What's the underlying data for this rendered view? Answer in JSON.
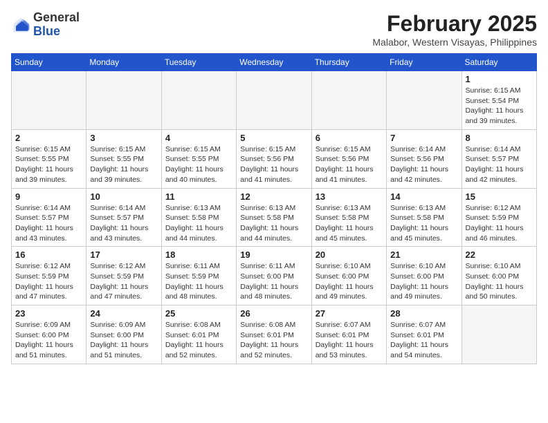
{
  "header": {
    "logo_general": "General",
    "logo_blue": "Blue",
    "month_year": "February 2025",
    "location": "Malabor, Western Visayas, Philippines"
  },
  "days_of_week": [
    "Sunday",
    "Monday",
    "Tuesday",
    "Wednesday",
    "Thursday",
    "Friday",
    "Saturday"
  ],
  "weeks": [
    [
      {
        "day": "",
        "info": ""
      },
      {
        "day": "",
        "info": ""
      },
      {
        "day": "",
        "info": ""
      },
      {
        "day": "",
        "info": ""
      },
      {
        "day": "",
        "info": ""
      },
      {
        "day": "",
        "info": ""
      },
      {
        "day": "1",
        "info": "Sunrise: 6:15 AM\nSunset: 5:54 PM\nDaylight: 11 hours\nand 39 minutes."
      }
    ],
    [
      {
        "day": "2",
        "info": "Sunrise: 6:15 AM\nSunset: 5:55 PM\nDaylight: 11 hours\nand 39 minutes."
      },
      {
        "day": "3",
        "info": "Sunrise: 6:15 AM\nSunset: 5:55 PM\nDaylight: 11 hours\nand 39 minutes."
      },
      {
        "day": "4",
        "info": "Sunrise: 6:15 AM\nSunset: 5:55 PM\nDaylight: 11 hours\nand 40 minutes."
      },
      {
        "day": "5",
        "info": "Sunrise: 6:15 AM\nSunset: 5:56 PM\nDaylight: 11 hours\nand 41 minutes."
      },
      {
        "day": "6",
        "info": "Sunrise: 6:15 AM\nSunset: 5:56 PM\nDaylight: 11 hours\nand 41 minutes."
      },
      {
        "day": "7",
        "info": "Sunrise: 6:14 AM\nSunset: 5:56 PM\nDaylight: 11 hours\nand 42 minutes."
      },
      {
        "day": "8",
        "info": "Sunrise: 6:14 AM\nSunset: 5:57 PM\nDaylight: 11 hours\nand 42 minutes."
      }
    ],
    [
      {
        "day": "9",
        "info": "Sunrise: 6:14 AM\nSunset: 5:57 PM\nDaylight: 11 hours\nand 43 minutes."
      },
      {
        "day": "10",
        "info": "Sunrise: 6:14 AM\nSunset: 5:57 PM\nDaylight: 11 hours\nand 43 minutes."
      },
      {
        "day": "11",
        "info": "Sunrise: 6:13 AM\nSunset: 5:58 PM\nDaylight: 11 hours\nand 44 minutes."
      },
      {
        "day": "12",
        "info": "Sunrise: 6:13 AM\nSunset: 5:58 PM\nDaylight: 11 hours\nand 44 minutes."
      },
      {
        "day": "13",
        "info": "Sunrise: 6:13 AM\nSunset: 5:58 PM\nDaylight: 11 hours\nand 45 minutes."
      },
      {
        "day": "14",
        "info": "Sunrise: 6:13 AM\nSunset: 5:58 PM\nDaylight: 11 hours\nand 45 minutes."
      },
      {
        "day": "15",
        "info": "Sunrise: 6:12 AM\nSunset: 5:59 PM\nDaylight: 11 hours\nand 46 minutes."
      }
    ],
    [
      {
        "day": "16",
        "info": "Sunrise: 6:12 AM\nSunset: 5:59 PM\nDaylight: 11 hours\nand 47 minutes."
      },
      {
        "day": "17",
        "info": "Sunrise: 6:12 AM\nSunset: 5:59 PM\nDaylight: 11 hours\nand 47 minutes."
      },
      {
        "day": "18",
        "info": "Sunrise: 6:11 AM\nSunset: 5:59 PM\nDaylight: 11 hours\nand 48 minutes."
      },
      {
        "day": "19",
        "info": "Sunrise: 6:11 AM\nSunset: 6:00 PM\nDaylight: 11 hours\nand 48 minutes."
      },
      {
        "day": "20",
        "info": "Sunrise: 6:10 AM\nSunset: 6:00 PM\nDaylight: 11 hours\nand 49 minutes."
      },
      {
        "day": "21",
        "info": "Sunrise: 6:10 AM\nSunset: 6:00 PM\nDaylight: 11 hours\nand 49 minutes."
      },
      {
        "day": "22",
        "info": "Sunrise: 6:10 AM\nSunset: 6:00 PM\nDaylight: 11 hours\nand 50 minutes."
      }
    ],
    [
      {
        "day": "23",
        "info": "Sunrise: 6:09 AM\nSunset: 6:00 PM\nDaylight: 11 hours\nand 51 minutes."
      },
      {
        "day": "24",
        "info": "Sunrise: 6:09 AM\nSunset: 6:00 PM\nDaylight: 11 hours\nand 51 minutes."
      },
      {
        "day": "25",
        "info": "Sunrise: 6:08 AM\nSunset: 6:01 PM\nDaylight: 11 hours\nand 52 minutes."
      },
      {
        "day": "26",
        "info": "Sunrise: 6:08 AM\nSunset: 6:01 PM\nDaylight: 11 hours\nand 52 minutes."
      },
      {
        "day": "27",
        "info": "Sunrise: 6:07 AM\nSunset: 6:01 PM\nDaylight: 11 hours\nand 53 minutes."
      },
      {
        "day": "28",
        "info": "Sunrise: 6:07 AM\nSunset: 6:01 PM\nDaylight: 11 hours\nand 54 minutes."
      },
      {
        "day": "",
        "info": ""
      }
    ]
  ]
}
